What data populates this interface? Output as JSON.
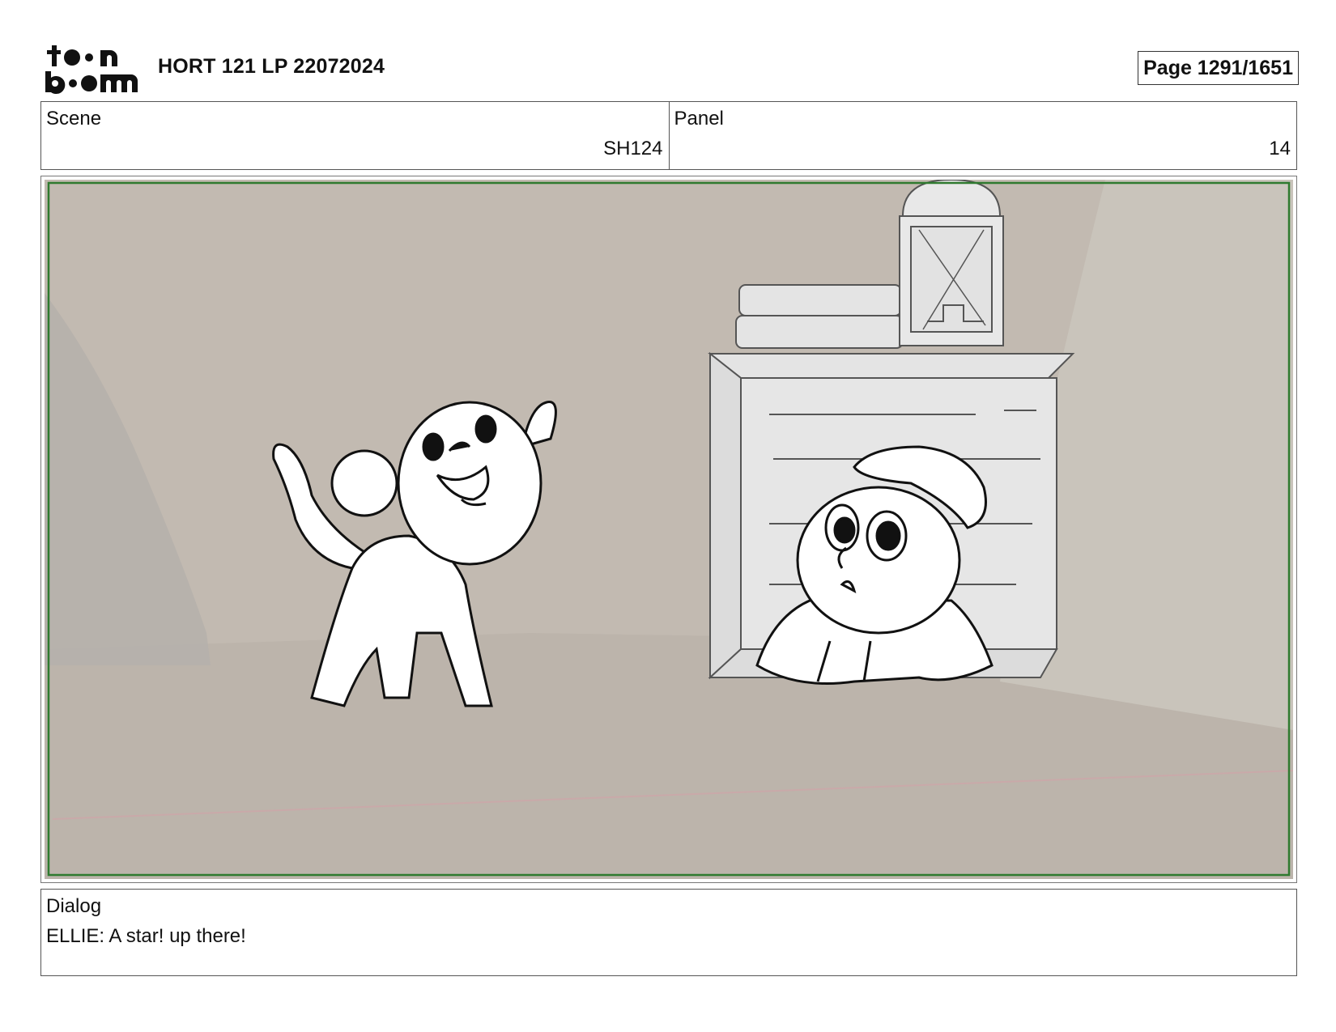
{
  "header": {
    "logo_alt": "toon boom",
    "title": "HORT 121 LP 22072024",
    "page_label": "Page 1291/1651"
  },
  "scene": {
    "label": "Scene",
    "value": "SH124"
  },
  "panel": {
    "label": "Panel",
    "value": "14"
  },
  "dialog": {
    "label": "Dialog",
    "text": "ELLIE: A star! up there!"
  },
  "colors": {
    "frame_border": "#2f7a2f",
    "background_wall": "#c2bab1",
    "floor": "#bbb3aa",
    "props": "#e3e3e3",
    "ink": "#111111"
  }
}
